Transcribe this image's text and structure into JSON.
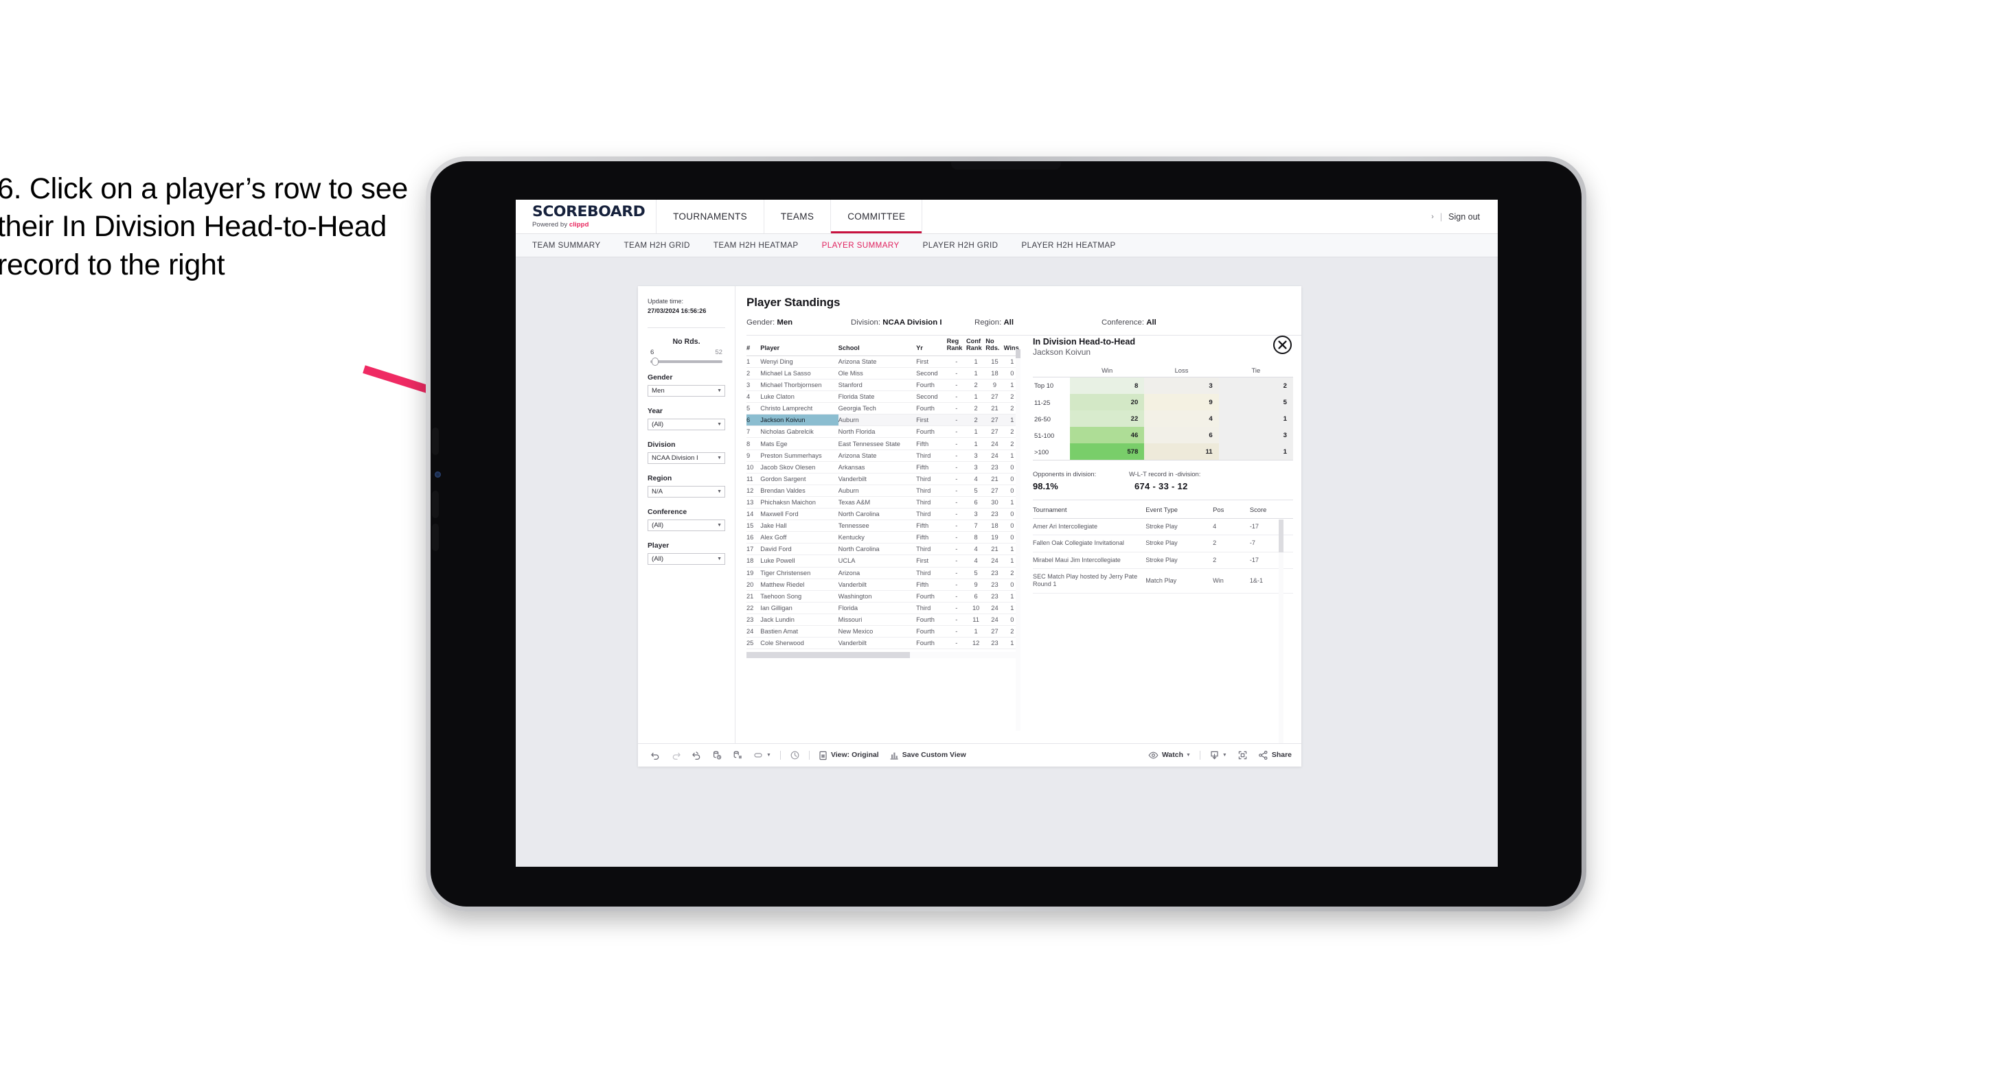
{
  "caption": "6. Click on a player’s row to see their In Division Head-to-Head record to the right",
  "topnav": {
    "brand_name": "SCOREBOARD",
    "brand_powered": "Powered by",
    "brand_product": "clippd",
    "items": [
      {
        "label": "TOURNAMENTS",
        "active": false
      },
      {
        "label": "TEAMS",
        "active": false
      },
      {
        "label": "COMMITTEE",
        "active": true
      }
    ],
    "chevron": "›",
    "divider": "|",
    "sign_out": "Sign out"
  },
  "subnav": {
    "tabs": [
      {
        "label": "TEAM SUMMARY",
        "active": false
      },
      {
        "label": "TEAM H2H GRID",
        "active": false
      },
      {
        "label": "TEAM H2H HEATMAP",
        "active": false
      },
      {
        "label": "PLAYER SUMMARY",
        "active": true
      },
      {
        "label": "PLAYER H2H GRID",
        "active": false
      },
      {
        "label": "PLAYER H2H HEATMAP",
        "active": false
      }
    ]
  },
  "filters": {
    "update_label": "Update time:",
    "update_value": "27/03/2024 16:56:26",
    "slider": {
      "label": "No Rds.",
      "min": "6",
      "max": "52"
    },
    "fields": [
      {
        "label": "Gender",
        "value": "Men"
      },
      {
        "label": "Year",
        "value": "(All)"
      },
      {
        "label": "Division",
        "value": "NCAA Division I"
      },
      {
        "label": "Region",
        "value": "N/A"
      },
      {
        "label": "Conference",
        "value": "(All)"
      },
      {
        "label": "Player",
        "value": "(All)"
      }
    ]
  },
  "dashboard": {
    "title": "Player Standings",
    "summary": [
      {
        "label": "Gender:",
        "value": "Men"
      },
      {
        "label": "Division:",
        "value": "NCAA Division I"
      },
      {
        "label": "Region:",
        "value": "All"
      },
      {
        "label": "Conference:",
        "value": "All"
      }
    ]
  },
  "standings": {
    "columns": [
      "#",
      "Player",
      "School",
      "Yr",
      "Reg Rank",
      "Conf Rank",
      "No Rds.",
      "Wins"
    ],
    "column_lines": [
      [
        "#",
        ""
      ],
      [
        "Player",
        ""
      ],
      [
        "School",
        ""
      ],
      [
        "Yr",
        ""
      ],
      [
        "Reg",
        "Rank"
      ],
      [
        "Conf",
        "Rank"
      ],
      [
        "No",
        "Rds."
      ],
      [
        "Wins",
        ""
      ]
    ],
    "rows": [
      {
        "num": "1",
        "player": "Wenyi Ding",
        "school": "Arizona State",
        "yr": "First",
        "reg": "-",
        "conf": "1",
        "rds": "15",
        "wins": "1",
        "selected": false
      },
      {
        "num": "2",
        "player": "Michael La Sasso",
        "school": "Ole Miss",
        "yr": "Second",
        "reg": "-",
        "conf": "1",
        "rds": "18",
        "wins": "0",
        "selected": false
      },
      {
        "num": "3",
        "player": "Michael Thorbjornsen",
        "school": "Stanford",
        "yr": "Fourth",
        "reg": "-",
        "conf": "2",
        "rds": "9",
        "wins": "1",
        "selected": false
      },
      {
        "num": "4",
        "player": "Luke Claton",
        "school": "Florida State",
        "yr": "Second",
        "reg": "-",
        "conf": "1",
        "rds": "27",
        "wins": "2",
        "selected": false
      },
      {
        "num": "5",
        "player": "Christo Lamprecht",
        "school": "Georgia Tech",
        "yr": "Fourth",
        "reg": "-",
        "conf": "2",
        "rds": "21",
        "wins": "2",
        "selected": false
      },
      {
        "num": "6",
        "player": "Jackson Koivun",
        "school": "Auburn",
        "yr": "First",
        "reg": "-",
        "conf": "2",
        "rds": "27",
        "wins": "1",
        "selected": true
      },
      {
        "num": "7",
        "player": "Nicholas Gabrelcik",
        "school": "North Florida",
        "yr": "Fourth",
        "reg": "-",
        "conf": "1",
        "rds": "27",
        "wins": "2",
        "selected": false
      },
      {
        "num": "8",
        "player": "Mats Ege",
        "school": "East Tennessee State",
        "yr": "Fifth",
        "reg": "-",
        "conf": "1",
        "rds": "24",
        "wins": "2",
        "selected": false
      },
      {
        "num": "9",
        "player": "Preston Summerhays",
        "school": "Arizona State",
        "yr": "Third",
        "reg": "-",
        "conf": "3",
        "rds": "24",
        "wins": "1",
        "selected": false
      },
      {
        "num": "10",
        "player": "Jacob Skov Olesen",
        "school": "Arkansas",
        "yr": "Fifth",
        "reg": "-",
        "conf": "3",
        "rds": "23",
        "wins": "0",
        "selected": false
      },
      {
        "num": "11",
        "player": "Gordon Sargent",
        "school": "Vanderbilt",
        "yr": "Third",
        "reg": "-",
        "conf": "4",
        "rds": "21",
        "wins": "0",
        "selected": false
      },
      {
        "num": "12",
        "player": "Brendan Valdes",
        "school": "Auburn",
        "yr": "Third",
        "reg": "-",
        "conf": "5",
        "rds": "27",
        "wins": "0",
        "selected": false
      },
      {
        "num": "13",
        "player": "Phichaksn Maichon",
        "school": "Texas A&M",
        "yr": "Third",
        "reg": "-",
        "conf": "6",
        "rds": "30",
        "wins": "1",
        "selected": false
      },
      {
        "num": "14",
        "player": "Maxwell Ford",
        "school": "North Carolina",
        "yr": "Third",
        "reg": "-",
        "conf": "3",
        "rds": "23",
        "wins": "0",
        "selected": false
      },
      {
        "num": "15",
        "player": "Jake Hall",
        "school": "Tennessee",
        "yr": "Fifth",
        "reg": "-",
        "conf": "7",
        "rds": "18",
        "wins": "0",
        "selected": false
      },
      {
        "num": "16",
        "player": "Alex Goff",
        "school": "Kentucky",
        "yr": "Fifth",
        "reg": "-",
        "conf": "8",
        "rds": "19",
        "wins": "0",
        "selected": false
      },
      {
        "num": "17",
        "player": "David Ford",
        "school": "North Carolina",
        "yr": "Third",
        "reg": "-",
        "conf": "4",
        "rds": "21",
        "wins": "1",
        "selected": false
      },
      {
        "num": "18",
        "player": "Luke Powell",
        "school": "UCLA",
        "yr": "First",
        "reg": "-",
        "conf": "4",
        "rds": "24",
        "wins": "1",
        "selected": false
      },
      {
        "num": "19",
        "player": "Tiger Christensen",
        "school": "Arizona",
        "yr": "Third",
        "reg": "-",
        "conf": "5",
        "rds": "23",
        "wins": "2",
        "selected": false
      },
      {
        "num": "20",
        "player": "Matthew Riedel",
        "school": "Vanderbilt",
        "yr": "Fifth",
        "reg": "-",
        "conf": "9",
        "rds": "23",
        "wins": "0",
        "selected": false
      },
      {
        "num": "21",
        "player": "Taehoon Song",
        "school": "Washington",
        "yr": "Fourth",
        "reg": "-",
        "conf": "6",
        "rds": "23",
        "wins": "1",
        "selected": false
      },
      {
        "num": "22",
        "player": "Ian Gilligan",
        "school": "Florida",
        "yr": "Third",
        "reg": "-",
        "conf": "10",
        "rds": "24",
        "wins": "1",
        "selected": false
      },
      {
        "num": "23",
        "player": "Jack Lundin",
        "school": "Missouri",
        "yr": "Fourth",
        "reg": "-",
        "conf": "11",
        "rds": "24",
        "wins": "0",
        "selected": false
      },
      {
        "num": "24",
        "player": "Bastien Amat",
        "school": "New Mexico",
        "yr": "Fourth",
        "reg": "-",
        "conf": "1",
        "rds": "27",
        "wins": "2",
        "selected": false
      },
      {
        "num": "25",
        "player": "Cole Sherwood",
        "school": "Vanderbilt",
        "yr": "Fourth",
        "reg": "-",
        "conf": "12",
        "rds": "23",
        "wins": "1",
        "selected": false
      }
    ]
  },
  "h2h": {
    "title": "In Division Head-to-Head",
    "player": "Jackson Koivun",
    "close_icon": "close-icon",
    "opponents_label": "Opponents in division:",
    "opponents_value": "98.1%",
    "record_label": "W-L-T record in -division:",
    "record_value": "674 - 33 - 12"
  },
  "chart_data": {
    "type": "heatmap",
    "title": "In Division Head-to-Head",
    "subtitle": "Jackson Koivun",
    "columns": [
      "Win",
      "Loss",
      "Tie"
    ],
    "rows": [
      "Top 10",
      "11-25",
      "26-50",
      "51-100",
      ">100"
    ],
    "values": [
      [
        8,
        3,
        2
      ],
      [
        20,
        9,
        5
      ],
      [
        22,
        4,
        1
      ],
      [
        46,
        6,
        3
      ],
      [
        578,
        11,
        1
      ]
    ],
    "cell_colors": [
      [
        "#e8f1e4",
        "#f0efeb",
        "#efefef"
      ],
      [
        "#d3e8c6",
        "#f4f1e2",
        "#efefef"
      ],
      [
        "#d8ebcd",
        "#f3f1e7",
        "#efefef"
      ],
      [
        "#aedd96",
        "#f2f0e8",
        "#efefef"
      ],
      [
        "#79ce6a",
        "#eeeada",
        "#efefef"
      ]
    ],
    "legend": "none",
    "grid": false
  },
  "tournaments": {
    "columns": [
      "Tournament",
      "Event Type",
      "Pos",
      "Score"
    ],
    "rows": [
      {
        "name": "Amer Ari Intercollegiate",
        "type": "Stroke Play",
        "pos": "4",
        "score": "-17"
      },
      {
        "name": "Fallen Oak Collegiate Invitational",
        "type": "Stroke Play",
        "pos": "2",
        "score": "-7"
      },
      {
        "name": "Mirabel Maui Jim Intercollegiate",
        "type": "Stroke Play",
        "pos": "2",
        "score": "-17"
      },
      {
        "name": "SEC Match Play hosted by Jerry Pate Round 1",
        "type": "Match Play",
        "pos": "Win",
        "score": "1&-1"
      }
    ]
  },
  "toolbar": {
    "undo": "undo-icon",
    "redo": "redo-icon",
    "revert": "revert-icon",
    "refresh": "refresh-data-icon",
    "pause": "pause-auto-update-icon",
    "view_dropdown": "view-dropdown-icon",
    "history": "history-icon",
    "view_label": "View: Original",
    "save_label": "Save Custom View",
    "watch_label": "Watch",
    "download": "download-icon",
    "fullscreen": "fullscreen-icon",
    "share_label": "Share"
  }
}
